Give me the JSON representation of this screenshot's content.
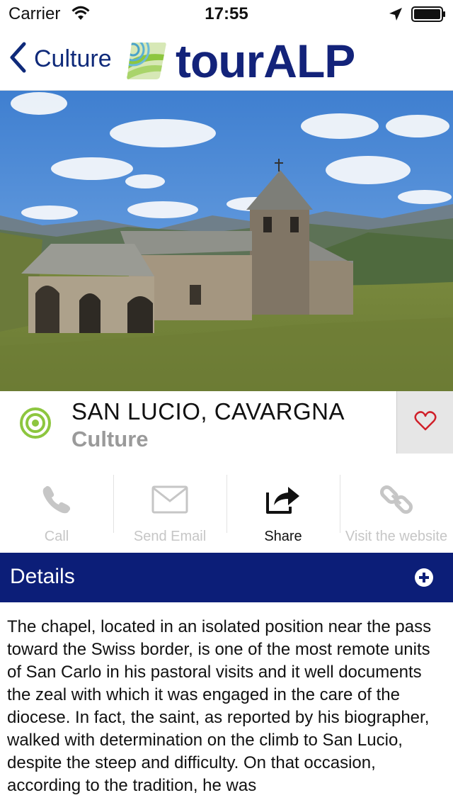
{
  "status_bar": {
    "carrier": "Carrier",
    "time": "17:55"
  },
  "nav": {
    "back_label": "Culture",
    "logo_text": "tourALP"
  },
  "place": {
    "name": "SAN LUCIO, CAVARGNA",
    "category": "Culture"
  },
  "actions": [
    {
      "label": "Call",
      "icon": "phone-icon",
      "enabled": false
    },
    {
      "label": "Send Email",
      "icon": "mail-icon",
      "enabled": false
    },
    {
      "label": "Share",
      "icon": "share-icon",
      "enabled": true
    },
    {
      "label": "Visit the website",
      "icon": "link-icon",
      "enabled": false
    }
  ],
  "details": {
    "label": "Details"
  },
  "description": "The chapel, located in an isolated position near the pass toward the Swiss border, is one of the most remote units of San Carlo in his pastoral visits and it well documents the zeal with which it was engaged in the care of the diocese. In fact, the saint, as reported by his biographer, walked with determination on the climb to San Lucio, despite the steep and difficulty. On that occasion, according to the tradition, he was",
  "colors": {
    "brand_navy": "#0c1e78",
    "logo_blue": "#13237a",
    "category_green": "#8dc63f",
    "favorite_red": "#d0202a",
    "disabled_gray": "#c6c6c6"
  }
}
